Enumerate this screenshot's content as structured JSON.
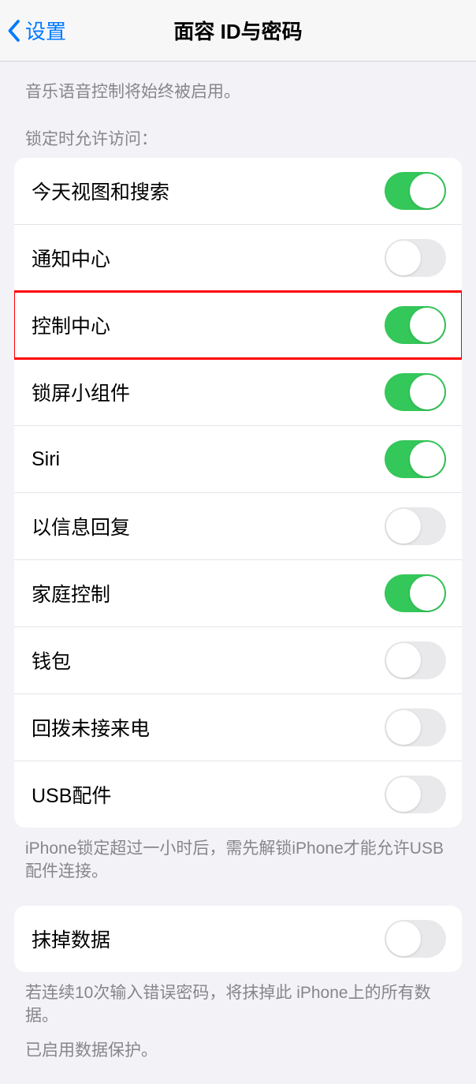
{
  "header": {
    "back_label": "设置",
    "title": "面容 ID与密码"
  },
  "top_note": "音乐语音控制将始终被启用。",
  "lock_access": {
    "header": "锁定时允许访问：",
    "items": [
      {
        "label": "今天视图和搜索",
        "on": true,
        "highlighted": false,
        "name": "today-view-search"
      },
      {
        "label": "通知中心",
        "on": false,
        "highlighted": false,
        "name": "notification-center"
      },
      {
        "label": "控制中心",
        "on": true,
        "highlighted": true,
        "name": "control-center"
      },
      {
        "label": "锁屏小组件",
        "on": true,
        "highlighted": false,
        "name": "lock-screen-widgets"
      },
      {
        "label": "Siri",
        "on": true,
        "highlighted": false,
        "name": "siri"
      },
      {
        "label": "以信息回复",
        "on": false,
        "highlighted": false,
        "name": "reply-with-message"
      },
      {
        "label": "家庭控制",
        "on": true,
        "highlighted": false,
        "name": "home-control"
      },
      {
        "label": "钱包",
        "on": false,
        "highlighted": false,
        "name": "wallet"
      },
      {
        "label": "回拨未接来电",
        "on": false,
        "highlighted": false,
        "name": "return-missed-calls"
      },
      {
        "label": "USB配件",
        "on": false,
        "highlighted": false,
        "name": "usb-accessories"
      }
    ],
    "footer": "iPhone锁定超过一小时后，需先解锁iPhone才能允许USB配件连接。"
  },
  "erase": {
    "label": "抹掉数据",
    "on": false,
    "footer": "若连续10次输入错误密码，将抹掉此 iPhone上的所有数据。",
    "footer2": "已启用数据保护。"
  }
}
